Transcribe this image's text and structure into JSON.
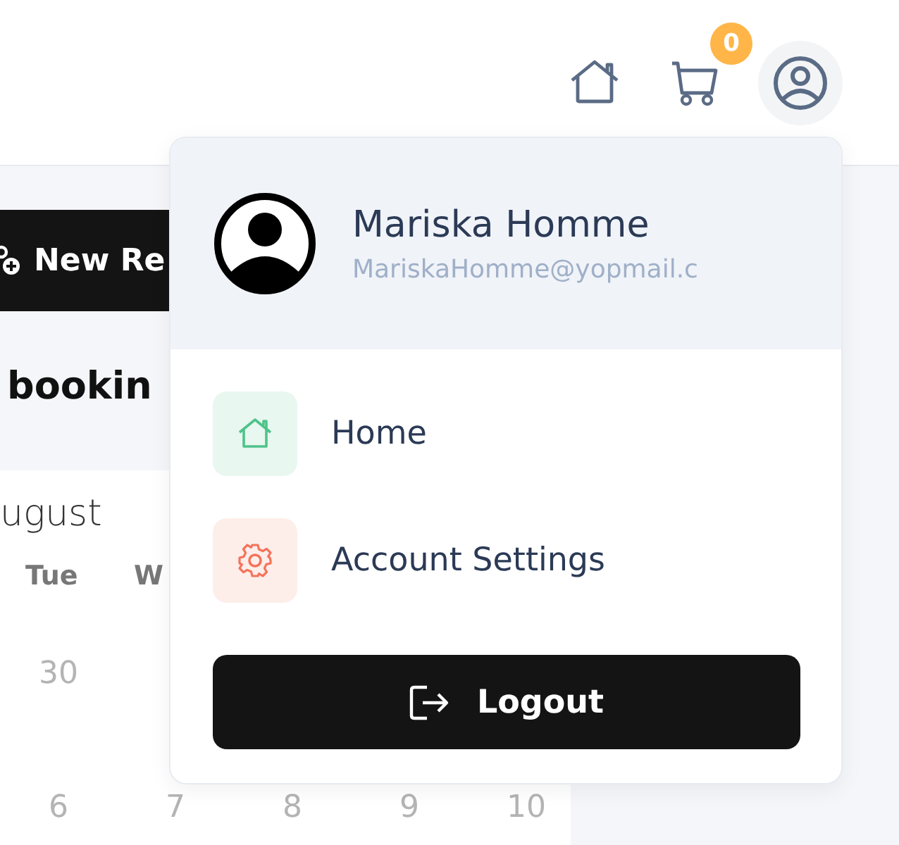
{
  "header": {
    "cart_count": "0"
  },
  "page": {
    "new_button": "New Re",
    "title": "bookin",
    "calendar": {
      "month": "ugust",
      "weekdays": [
        "Tue",
        "W"
      ],
      "rows": [
        [
          "30"
        ],
        [
          "6",
          "7",
          "8",
          "9",
          "10"
        ]
      ]
    }
  },
  "profile_menu": {
    "name": "Mariska Homme",
    "email": "MariskaHomme@yopmail.c",
    "items": [
      {
        "kind": "home",
        "label": "Home"
      },
      {
        "kind": "settings",
        "label": "Account Settings"
      }
    ],
    "logout": "Logout"
  }
}
